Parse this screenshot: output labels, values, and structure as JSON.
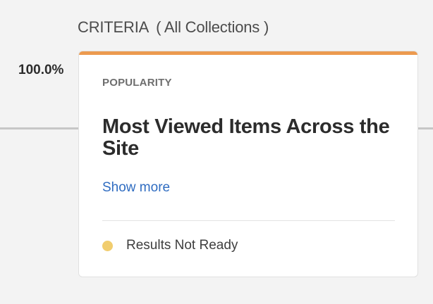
{
  "criteria": {
    "label": "CRITERIA",
    "scope": "( All Collections )"
  },
  "flow": {
    "percent": "100.0%"
  },
  "card": {
    "category": "POPULARITY",
    "title": "Most Viewed Items Across the Site",
    "show_more": "Show more",
    "status": {
      "label": "Results Not Ready",
      "icon": "status-dot-icon"
    }
  },
  "colors": {
    "accent": "#ec9a4f",
    "link": "#2f6cc1",
    "status_pending": "#f1cd6e"
  }
}
